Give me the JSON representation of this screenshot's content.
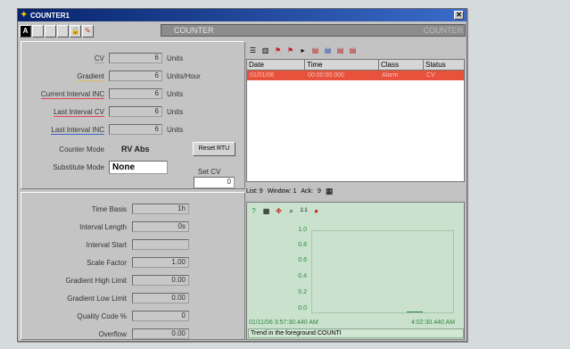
{
  "window": {
    "title": "COUNTER1",
    "close": "✕"
  },
  "toolbar": {
    "mode_label": "A",
    "bar_left": "COUNTER",
    "bar_right": "COUNTER"
  },
  "counter_fields": [
    {
      "label": "CV",
      "value": "6",
      "unit": "Units"
    },
    {
      "label": "Gradient",
      "value": "6",
      "unit": "Units/Hour"
    },
    {
      "label": "Current Interval INC",
      "value": "6",
      "unit": "Units"
    },
    {
      "label": "Last Interval CV",
      "value": "6",
      "unit": "Units"
    },
    {
      "label": "Last Interval INC",
      "value": "6",
      "unit": "Units"
    }
  ],
  "counter_mode": {
    "label": "Counter Mode",
    "value": "RV Abs"
  },
  "reset_button": "Reset RTU",
  "substitute_mode": {
    "label": "Substitute Mode",
    "value": "None"
  },
  "set_cv": {
    "label": "Set CV",
    "value": "0"
  },
  "config_fields": [
    {
      "label": "Time Basis",
      "value": "1h"
    },
    {
      "label": "Interval Length",
      "value": "0s"
    },
    {
      "label": "Interval Start",
      "value": ""
    },
    {
      "label": "Scale Factor",
      "value": "1.00"
    },
    {
      "label": "Gradient High Limit",
      "value": "0.00"
    },
    {
      "label": "Gradient Low Limit",
      "value": "0.00"
    },
    {
      "label": "Quality Code %",
      "value": "0"
    },
    {
      "label": "Overflow",
      "value": "0.00"
    }
  ],
  "alarm_table": {
    "headers": [
      "Date",
      "Time",
      "Class",
      "Status"
    ],
    "row": [
      "01/01/06",
      "00:00:00.000",
      "Alarm",
      "CV"
    ]
  },
  "alarm_status": {
    "list": "List: 9",
    "window": "Window: 1",
    "ack": "Ack:",
    "ack_count": "9"
  },
  "trend": {
    "yticks": [
      "1.0",
      "0.8",
      "0.6",
      "0.4",
      "0.2",
      "0.0"
    ],
    "start_time": "01/11/06 3:57:30.440 AM",
    "end_time": "4:02:30.440 AM",
    "status": "Trend in the foreground COUNTI"
  },
  "colors": {
    "title_bar": "#08246b",
    "alarm_row": "#e8513c",
    "trend_bg": "#c9e1cd",
    "trend_text": "#2e8a3e"
  }
}
